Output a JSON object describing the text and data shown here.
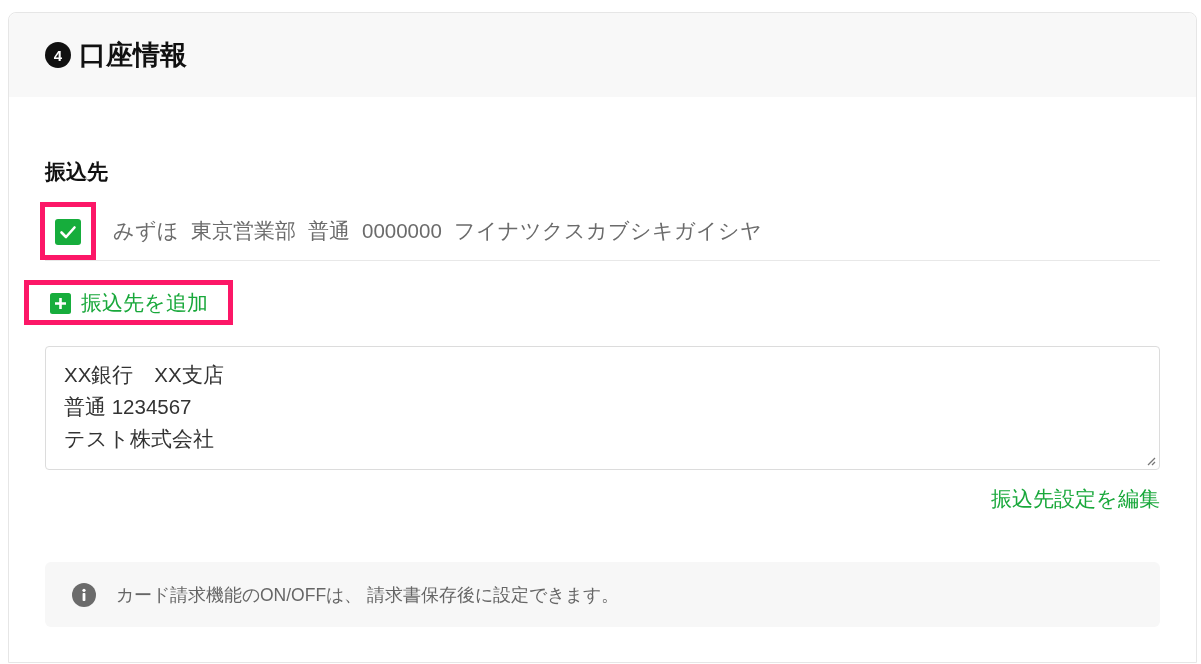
{
  "section": {
    "step": "4",
    "title": "口座情報"
  },
  "payee": {
    "label": "振込先",
    "accounts": [
      {
        "checked": true,
        "highlighted": true,
        "bank": "みずほ",
        "branch": "東京営業部",
        "type": "普通",
        "number": "0000000",
        "holder": "フイナツクスカブシキガイシヤ"
      }
    ],
    "add_button": {
      "label": "振込先を追加",
      "highlighted": true
    },
    "details": {
      "lines": [
        "XX銀行　XX支店",
        "普通 1234567",
        "テスト株式会社"
      ]
    },
    "edit_link": "振込先設定を編集"
  },
  "notice": {
    "text": "カード請求機能のON/OFFは、 請求書保存後に設定できます。"
  }
}
